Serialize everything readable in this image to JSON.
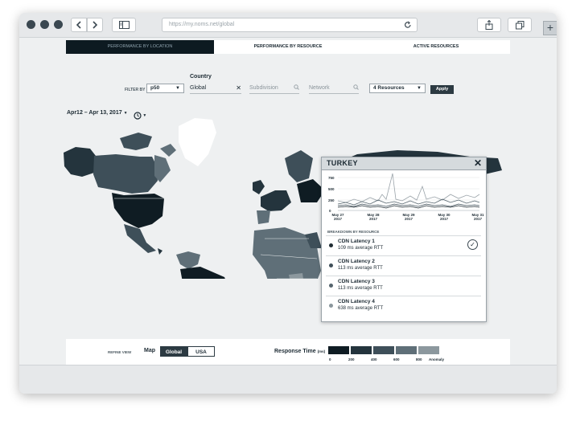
{
  "browser": {
    "url": "https://my.noms.net/global",
    "back_icon": "chevron-left-icon",
    "forward_icon": "chevron-right-icon",
    "sidebar_icon": "sidebar-icon",
    "reload_icon": "reload-icon",
    "share_icon": "share-icon",
    "tabs_icon": "tabs-icon",
    "new_tab": "+"
  },
  "tabs": [
    {
      "label": "PERFORMANCE BY LOCATION",
      "active": true
    },
    {
      "label": "PERFORMANCE BY RESOURCE",
      "active": false
    },
    {
      "label": "ACTIVE RESOURCES",
      "active": false
    }
  ],
  "filters": {
    "filter_by_label": "FILTER BY",
    "metric": "p50",
    "country_label": "Country",
    "country_value": "Global",
    "subdivision_placeholder": "Subdivision",
    "network_placeholder": "Network",
    "resources": "4 Resources",
    "apply_label": "Apply",
    "date_range": "Apr12 – Apr 13, 2017"
  },
  "popup": {
    "title": "TURKEY",
    "close": "✕",
    "y_ticks": [
      "750",
      "500",
      "250",
      "0"
    ],
    "x_ticks": [
      {
        "date": "May 27",
        "year": "2017"
      },
      {
        "date": "May 28",
        "year": "2017"
      },
      {
        "date": "May 29",
        "year": "2017"
      },
      {
        "date": "May 30",
        "year": "2017"
      },
      {
        "date": "May 31",
        "year": "2017"
      }
    ],
    "breakdown_label": "BREAKDOWN BY RESOURCE",
    "resources": [
      {
        "name": "CDN Latency 1",
        "stat": "109 ms average RTT",
        "color": "#1f2b32",
        "selected": true
      },
      {
        "name": "CDN Latency 2",
        "stat": "113 ms average RTT",
        "color": "#3f4f59",
        "selected": false
      },
      {
        "name": "CDN Latency  3",
        "stat": "113 ms average RTT",
        "color": "#55646d",
        "selected": false
      },
      {
        "name": "CDN Latency 4",
        "stat": "638 ms average RTT",
        "color": "#8a969c",
        "selected": false
      }
    ]
  },
  "bottom": {
    "refine_label": "REFINE VIEW",
    "map_label": "Map",
    "map_global": "Global",
    "map_usa": "USA",
    "response_label": "Response Time",
    "response_unit": "(ms)",
    "legend_colors": [
      "#0f1c23",
      "#24343d",
      "#3e4f59",
      "#5f6f78",
      "#8c989e",
      "#5c6b73"
    ],
    "legend_ticks": [
      "0",
      "200",
      "400",
      "600",
      "800",
      "Anomaly"
    ]
  }
}
